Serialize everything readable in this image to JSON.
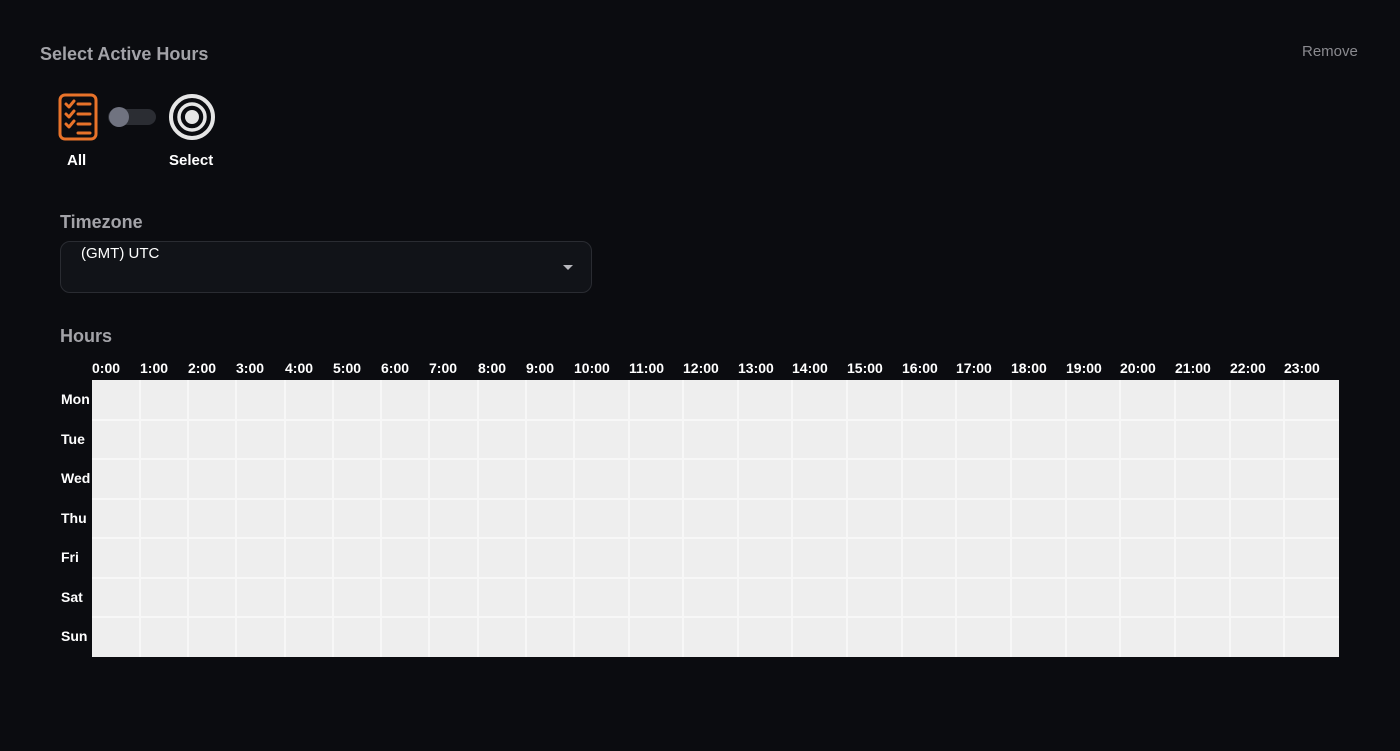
{
  "header": {
    "title": "Select Active Hours",
    "remove_label": "Remove"
  },
  "mode": {
    "all_label": "All",
    "select_label": "Select",
    "all_icon": "checklist-icon",
    "select_icon": "target-icon",
    "selected": "all",
    "colors": {
      "all_icon": "#e8732a",
      "select_icon": "#e6e6e6",
      "toggle_track": "#2b2d33",
      "toggle_knob": "#707380"
    }
  },
  "timezone": {
    "label": "Timezone",
    "value": "(GMT) UTC"
  },
  "hours_section": {
    "label": "Hours",
    "hours": [
      "0:00",
      "1:00",
      "2:00",
      "3:00",
      "4:00",
      "5:00",
      "6:00",
      "7:00",
      "8:00",
      "9:00",
      "10:00",
      "11:00",
      "12:00",
      "13:00",
      "14:00",
      "15:00",
      "16:00",
      "17:00",
      "18:00",
      "19:00",
      "20:00",
      "21:00",
      "22:00",
      "23:00"
    ],
    "days": [
      "Mon",
      "Tue",
      "Wed",
      "Thu",
      "Fri",
      "Sat",
      "Sun"
    ],
    "cell_color": "#eeeeee"
  }
}
